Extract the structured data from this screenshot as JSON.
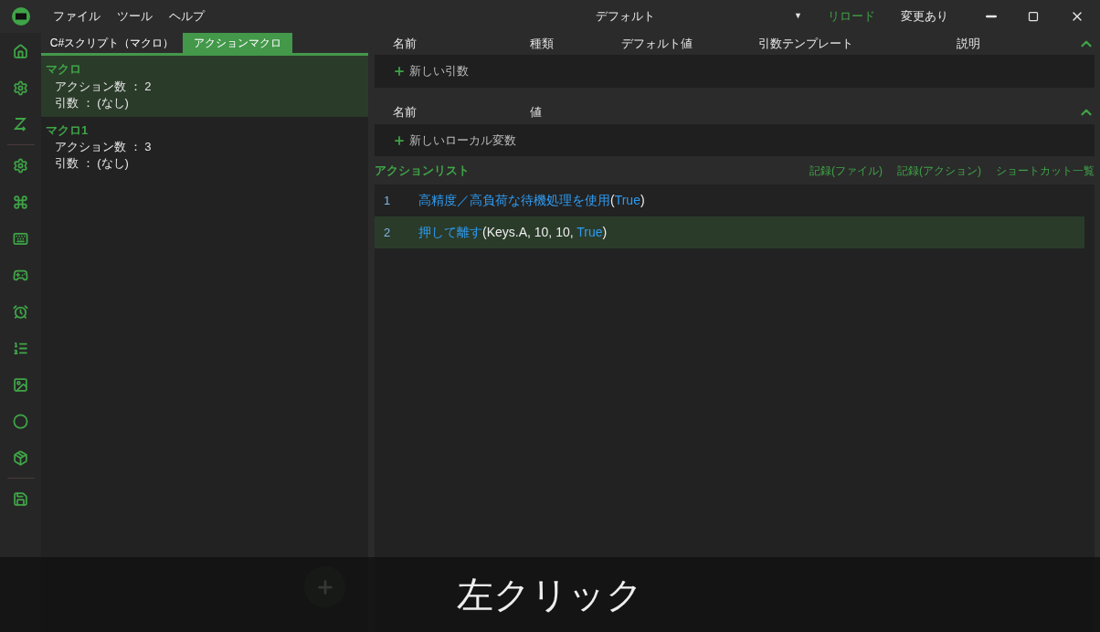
{
  "menu": [
    "ファイル",
    "ツール",
    "ヘルプ"
  ],
  "profile": {
    "value": "デフォルト",
    "arrow": "▼"
  },
  "reload": "リロード",
  "status": "変更あり",
  "tabs": [
    {
      "label": "C#スクリプト（マクロ）",
      "selected": false
    },
    {
      "label": "アクションマクロ",
      "selected": true
    }
  ],
  "macros": [
    {
      "name": "マクロ",
      "lines": [
        "アクション数 ： 2",
        "引数 ： (なし)"
      ],
      "selected": true
    },
    {
      "name": "マクロ1",
      "lines": [
        "アクション数 ： 3",
        "引数 ： (なし)"
      ],
      "selected": false
    }
  ],
  "arguments": {
    "columns": [
      "名前",
      "種類",
      "デフォルト値",
      "引数テンプレート",
      "説明"
    ],
    "expanded": true,
    "add": "新しい引数"
  },
  "locals": {
    "columns": [
      "名前",
      "値"
    ],
    "expanded": true,
    "add": "新しいローカル変数"
  },
  "action_list": {
    "title": "アクションリスト",
    "links": [
      "記録(ファイル)",
      "記録(アクション)",
      "ショートカット一覧"
    ],
    "rows": [
      {
        "number": "1",
        "selected": false,
        "segments": [
          {
            "text": "高精度／高負荷な待機処理を使用",
            "kind": "keyword"
          },
          {
            "text": "(",
            "kind": "plain"
          },
          {
            "text": "True",
            "kind": "keyword"
          },
          {
            "text": ")",
            "kind": "plain"
          }
        ]
      },
      {
        "number": "2",
        "selected": true,
        "segments": [
          {
            "text": "押して離す",
            "kind": "keyword"
          },
          {
            "text": "(Keys.A, 10, 10, ",
            "kind": "plain"
          },
          {
            "text": "True",
            "kind": "keyword"
          },
          {
            "text": ")",
            "kind": "plain"
          }
        ]
      }
    ]
  },
  "caption": "左クリック"
}
